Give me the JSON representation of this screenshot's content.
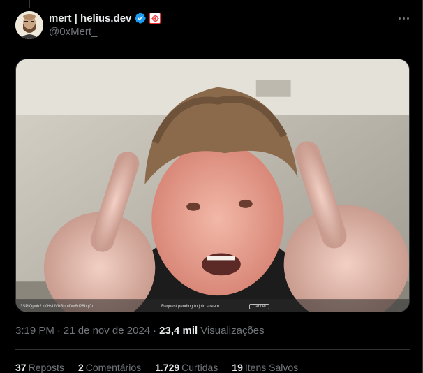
{
  "tweet": {
    "author": {
      "display_name": "mert | helius.dev",
      "handle": "@0xMert_",
      "verified_icon": "verified-badge-icon",
      "affiliation_icon": "helius-affiliate-badge-icon"
    },
    "media": {
      "overlay_id": "3SPiQpob2 rKHsUVbBbmDw6d28hqCn",
      "overlay_status": "Request pending to join stream",
      "overlay_cancel": "Cancel"
    },
    "time": "3:19 PM",
    "date": "21 de nov de 2024",
    "dot1": "·",
    "dot2": "·",
    "views_count": "23,4 mil",
    "views_label": "Visualizações",
    "stats": [
      {
        "num": "37",
        "label": "Reposts"
      },
      {
        "num": "2",
        "label": "Comentários"
      },
      {
        "num": "1.729",
        "label": "Curtidas"
      },
      {
        "num": "19",
        "label": "Itens Salvos"
      }
    ]
  },
  "colors": {
    "background": "#000000",
    "text_primary": "#e7e9ea",
    "text_secondary": "#71767b",
    "verified_blue": "#1d9bf0",
    "border": "#2f3336"
  }
}
